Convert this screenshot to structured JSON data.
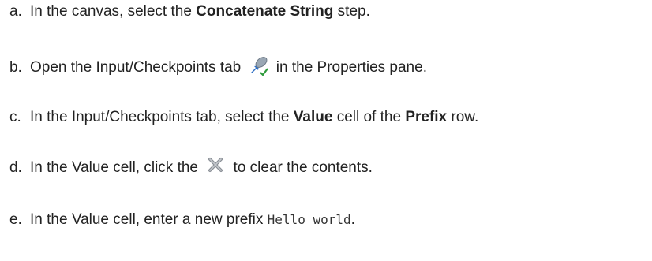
{
  "steps": [
    {
      "marker": "a.",
      "pre": "In the canvas, select the ",
      "bold1": "Concatenate String",
      "post": " step."
    },
    {
      "marker": "b.",
      "pre": "Open the Input/Checkpoints tab ",
      "icon": "input-checkpoints-tab-icon",
      "post": " in the Properties pane."
    },
    {
      "marker": "c.",
      "pre": "In the Input/Checkpoints tab, select the ",
      "bold1": "Value",
      "mid": " cell of the ",
      "bold2": "Prefix",
      "post": " row."
    },
    {
      "marker": "d.",
      "pre": "In the Value cell, click the ",
      "icon": "clear-x-icon",
      "post": " to clear the contents."
    },
    {
      "marker": "e.",
      "pre": "In the Value cell, enter a new prefix ",
      "code": "Hello world",
      "post": "."
    }
  ]
}
